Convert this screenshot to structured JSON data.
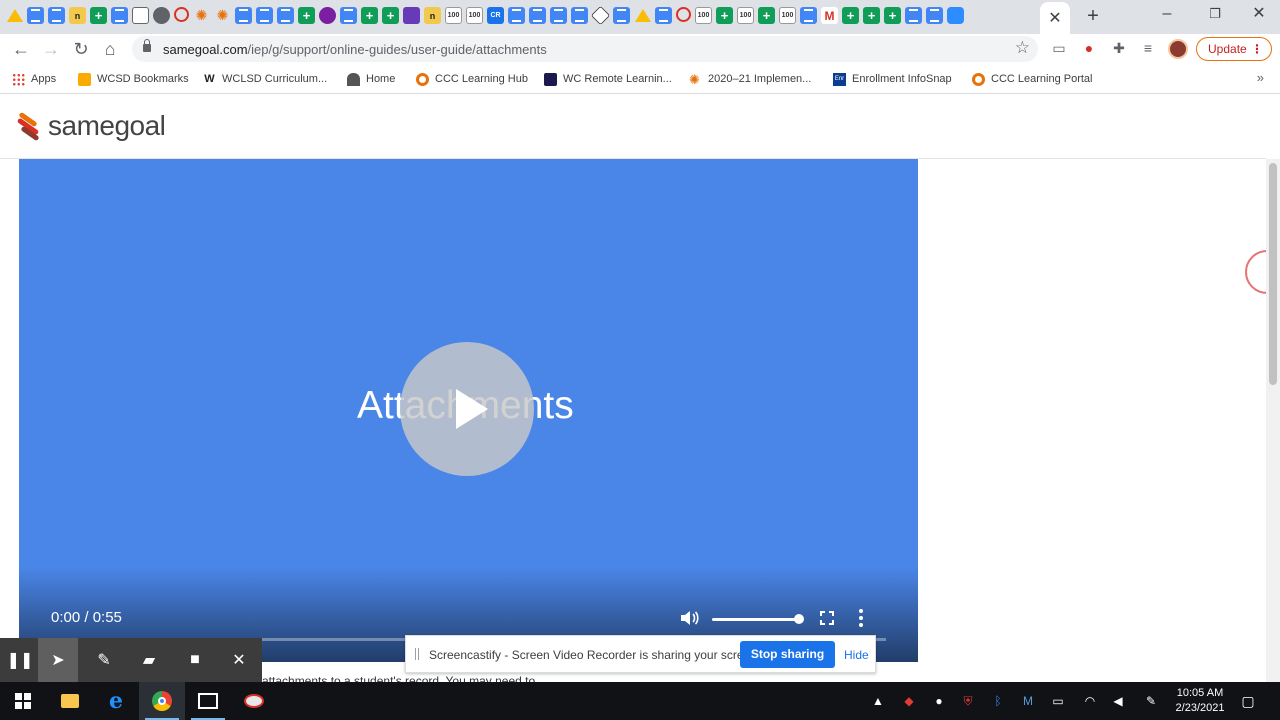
{
  "browser": {
    "url_domain": "samegoal.com",
    "url_path": "/iep/g/support/online-guides/user-guide/attachments",
    "update_label": "Update",
    "tab_close": "✕",
    "new_tab": "+",
    "window": {
      "minimize": "–",
      "maximize": "❐",
      "close": "✕"
    },
    "tab_favicons": [
      "drive",
      "doc",
      "doc",
      "n",
      "sheet",
      "doc",
      "calc",
      "globe",
      "circle",
      "star",
      "star",
      "doc",
      "doc",
      "doc",
      "sheet",
      "purple",
      "doc",
      "sheet",
      "sheet",
      "list",
      "n",
      "hundred",
      "hundred",
      "cr",
      "doc",
      "doc",
      "doc",
      "doc",
      "cube",
      "doc",
      "drive",
      "doc",
      "circle",
      "hundred",
      "sheet",
      "hundred",
      "sheet",
      "hundred",
      "doc",
      "gmail",
      "sheet",
      "sheet",
      "sheet",
      "doc",
      "doc",
      "zoom"
    ]
  },
  "bookmarks": [
    {
      "label": "Apps",
      "icon": "apps-grid-icon"
    },
    {
      "label": "WCSD Bookmarks",
      "icon": "folder-icon"
    },
    {
      "label": "WCLSD Curriculum...",
      "icon": "w-logo-icon"
    },
    {
      "label": "Home",
      "icon": "home-icon"
    },
    {
      "label": "CCC Learning Hub",
      "icon": "ccc-icon"
    },
    {
      "label": "WC Remote Learnin...",
      "icon": "wc-icon"
    },
    {
      "label": "2020–21 Implemen...",
      "icon": "burst-icon"
    },
    {
      "label": "Enrollment InfoSnap",
      "icon": "enr-icon"
    },
    {
      "label": "CCC Learning Portal",
      "icon": "ccc-icon"
    }
  ],
  "bookmarks_more": "»",
  "site": {
    "logo_text": "samegoal"
  },
  "video": {
    "title": "Attachments",
    "time": "0:00 / 0:55",
    "volume": 1.0,
    "progress": 0.0
  },
  "page_text": "attachments to a student's record. You may need to...",
  "screencastify": {
    "tools": [
      "pause-icon",
      "cursor-icon",
      "pen-icon",
      "eraser-icon",
      "camera-icon",
      "close-icon"
    ],
    "share_message": "Screencastify - Screen Video Recorder is sharing your screen.",
    "stop_label": "Stop sharing",
    "hide_label": "Hide"
  },
  "taskbar": {
    "time": "10:05 AM",
    "date": "2/23/2021"
  },
  "colors": {
    "video_bg": "#4a86e8",
    "stop_button": "#1a73e8",
    "update_border": "#e8710a"
  }
}
